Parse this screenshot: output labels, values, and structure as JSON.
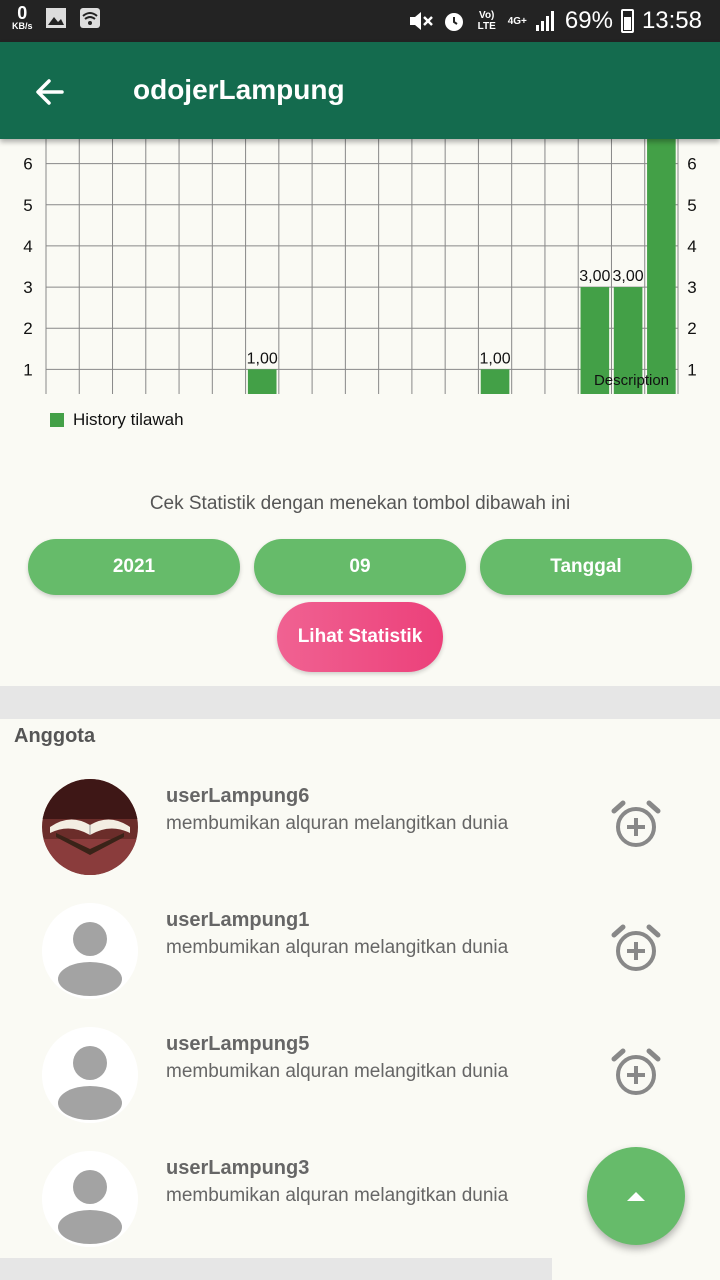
{
  "status_bar": {
    "speed_value": "0",
    "speed_unit": "KB/s",
    "network_label": "Vo) LTE",
    "signal_label": "4G+",
    "battery": "69%",
    "time": "13:58"
  },
  "app_bar": {
    "title": "odojerLampung"
  },
  "chart_data": {
    "type": "bar",
    "categories": [
      "",
      "",
      "",
      "",
      "",
      "",
      "",
      "",
      "",
      "",
      "",
      "",
      "",
      "",
      "",
      "",
      "",
      "",
      ""
    ],
    "values": [
      0,
      0,
      0,
      0,
      0,
      0,
      1,
      0,
      0,
      0,
      0,
      0,
      0,
      1,
      0,
      0,
      3,
      3,
      6.6
    ],
    "value_labels": [
      "",
      "",
      "",
      "",
      "",
      "",
      "1,00",
      "",
      "",
      "",
      "",
      "",
      "",
      "1,00",
      "",
      "",
      "3,00",
      "3,00",
      ""
    ],
    "series": [
      {
        "name": "History tilawah",
        "color": "#43a047"
      }
    ],
    "y_ticks": [
      "1",
      "2",
      "3",
      "4",
      "5",
      "6"
    ],
    "ylim": [
      0.4,
      6.6
    ],
    "description": "Description",
    "grid": true,
    "legend_position": "bottom-left"
  },
  "statistics": {
    "hint": "Cek Statistik dengan menekan tombol dibawah ini",
    "year": "2021",
    "month": "09",
    "day": "Tanggal",
    "submit": "Lihat Statistik"
  },
  "members": {
    "title": "Anggota",
    "items": [
      {
        "name": "userLampung6",
        "tagline": "membumikan alquran melangitkan dunia",
        "avatar": "quran-photo"
      },
      {
        "name": "userLampung1",
        "tagline": "membumikan alquran melangitkan dunia",
        "avatar": "default-person"
      },
      {
        "name": "userLampung5",
        "tagline": "membumikan alquran melangitkan dunia",
        "avatar": "default-person"
      },
      {
        "name": "userLampung3",
        "tagline": "membumikan alquran melangitkan dunia",
        "avatar": "default-person"
      }
    ]
  },
  "icons": {
    "back": "arrow-back-icon",
    "alarm": "alarm-add-icon",
    "fab": "arrow-up-icon"
  },
  "colors": {
    "primary": "#146b4e",
    "accent_green": "#66bb6a",
    "bar_green": "#43a047",
    "pink": "#ec407a"
  }
}
